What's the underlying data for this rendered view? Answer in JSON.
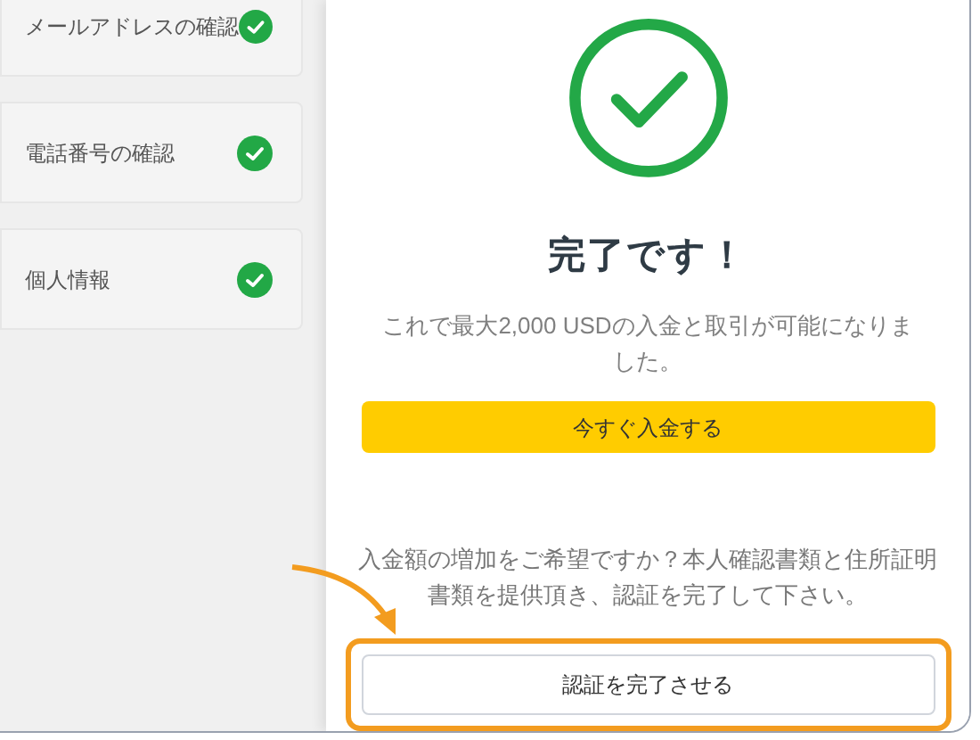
{
  "steps": [
    {
      "label": "メールアドレスの確認",
      "checked": true
    },
    {
      "label": "電話番号の確認",
      "checked": true
    },
    {
      "label": "個人情報",
      "checked": true
    }
  ],
  "completion": {
    "title": "完了です！",
    "message": "これで最大2,000 USDの入金と取引が可能になりました。",
    "deposit_button": "今すぐ入金する",
    "upgrade_message": "入金額の増加をご希望ですか？本人確認書類と住所証明書類を提供頂き、認証を完了して下さい。",
    "verify_button": "認証を完了させる",
    "verify_highlighted": true
  }
}
